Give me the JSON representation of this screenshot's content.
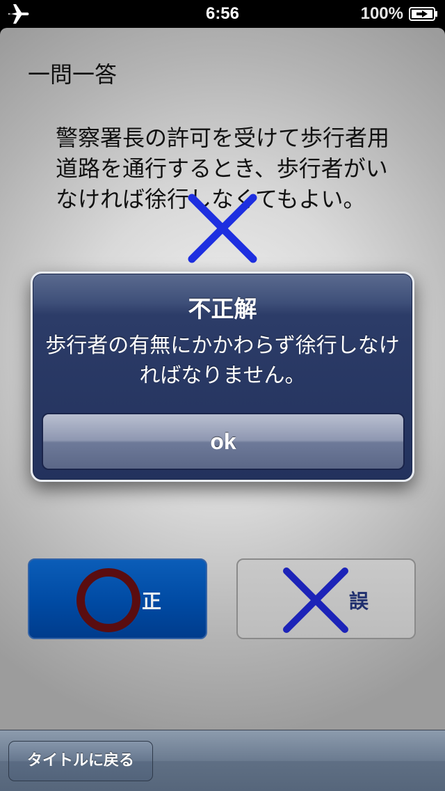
{
  "status_bar": {
    "airplane_icon": "airplane-icon",
    "time": "6:56",
    "battery_percent": "100%",
    "battery_icon": "battery-charging-icon"
  },
  "screen": {
    "title": "一問一答",
    "question": "警察署長の許可を受けて歩行者用道路を通行するとき、歩行者がいなければ徐行しなくてもよい。"
  },
  "alert": {
    "title": "不正解",
    "message": "歩行者の有無にかかわらず徐行しなければなりません。",
    "ok_label": "ok"
  },
  "answers": {
    "correct_label": "正",
    "wrong_label": "誤"
  },
  "toolbar": {
    "back_label": "タイトルに戻る"
  },
  "colors": {
    "x_mark": "#1e2fe0",
    "circle_mark": "#5a0d10",
    "alert_bg": "#23325d",
    "correct_button": "#004aa3"
  }
}
